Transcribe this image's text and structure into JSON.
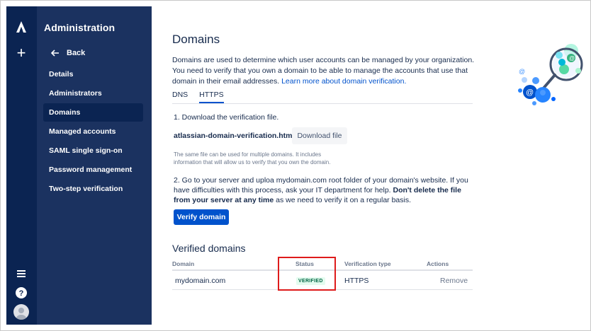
{
  "global_nav": {
    "icons": [
      "atlassian-logo",
      "plus-icon",
      "menu-icon",
      "help-icon",
      "avatar"
    ]
  },
  "sidebar": {
    "title": "Administration",
    "back_label": "Back",
    "items": [
      {
        "label": "Details",
        "active": false
      },
      {
        "label": "Administrators",
        "active": false
      },
      {
        "label": "Domains",
        "active": true
      },
      {
        "label": "Managed accounts",
        "active": false
      },
      {
        "label": "SAML single sign-on",
        "active": false
      },
      {
        "label": "Password management",
        "active": false
      },
      {
        "label": "Two-step verification",
        "active": false
      }
    ]
  },
  "main": {
    "title": "Domains",
    "description": "Domains are used to determine which user accounts can be managed by your organization. You need to verify that you own a domain to be able to manage the accounts that use that domain in their email addresses.",
    "description_link": "Learn more about domain verification.",
    "tabs": [
      {
        "label": "DNS",
        "active": false
      },
      {
        "label": "HTTPS",
        "active": true
      }
    ],
    "step1": "1. Download the verification file.",
    "file_name": "atlassian-domain-verification.html",
    "download_button": "Download file",
    "note": "The same file can be used for multiple domains. It includes information that will allow us to verify that you own the domain.",
    "step2_a": "2. Go to your server and uploa",
    "step2_domain": "mydomain.com",
    "step2_b": " root folder of your domain's website. If you have difficulties with this process, ask your IT department for help. ",
    "step2_bold": "Don't delete the file from your server at any time",
    "step2_c": " as we need to verify it on a regular basis.",
    "verify_button": "Verify domain",
    "verified_title": "Verified domains",
    "table": {
      "headers": [
        "Domain",
        "Status",
        "Verification type",
        "Actions"
      ],
      "rows": [
        {
          "domain": "mydomain.com",
          "status": "VERIFIED",
          "type": "HTTPS",
          "action": "Remove"
        }
      ]
    }
  },
  "colors": {
    "global_nav": "#0b2452",
    "sidebar": "#1b3260",
    "primary": "#0052cc",
    "highlight": "#de1b1b",
    "verified_bg": "#e3fcef",
    "verified_text": "#006644"
  }
}
